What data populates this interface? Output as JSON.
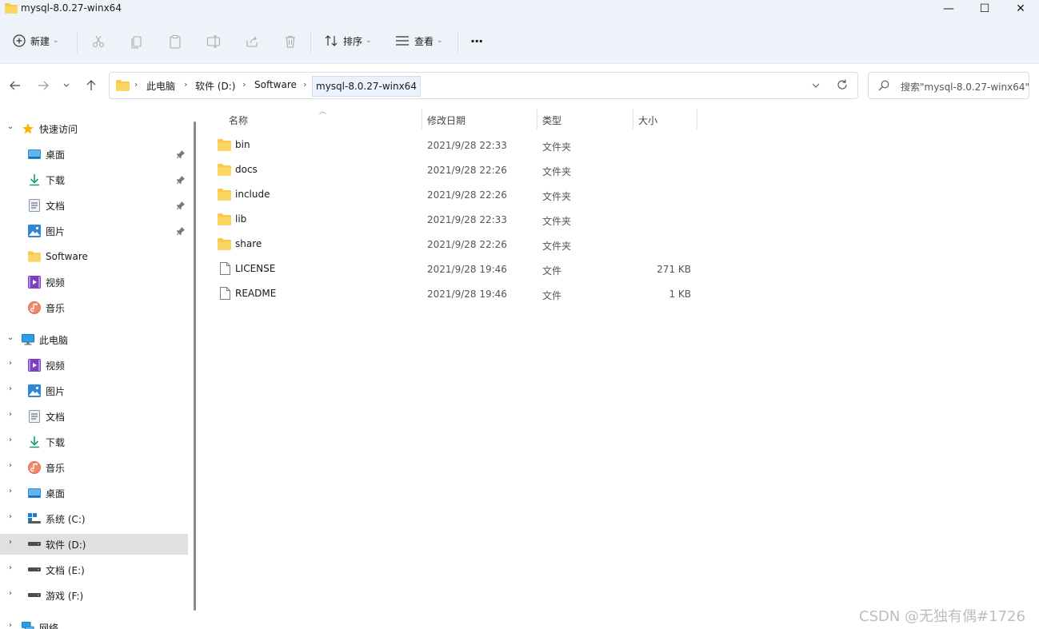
{
  "window": {
    "title": "mysql-8.0.27-winx64",
    "minimize_glyph": "—",
    "maximize_glyph": "☐",
    "close_glyph": "✕"
  },
  "toolbar": {
    "new_label": "新建",
    "sort_label": "排序",
    "view_label": "查看",
    "more_glyph": "···",
    "icons": [
      "cut-icon",
      "copy-icon",
      "paste-icon",
      "rename-icon",
      "share-icon",
      "delete-icon"
    ]
  },
  "address": {
    "crumbs": [
      "此电脑",
      "软件 (D:)",
      "Software",
      "mysql-8.0.27-winx64"
    ],
    "separator": "›"
  },
  "search": {
    "placeholder": "搜索\"mysql-8.0.27-winx64\""
  },
  "sidebar": {
    "quick_access": {
      "label": "快速访问",
      "items": [
        {
          "label": "桌面",
          "icon": "desktop-icon",
          "pinned": true
        },
        {
          "label": "下载",
          "icon": "download-icon",
          "pinned": true
        },
        {
          "label": "文档",
          "icon": "document-icon",
          "pinned": true
        },
        {
          "label": "图片",
          "icon": "pictures-icon",
          "pinned": true
        },
        {
          "label": "Software",
          "icon": "folder-icon",
          "pinned": false
        },
        {
          "label": "视频",
          "icon": "video-icon",
          "pinned": false
        },
        {
          "label": "音乐",
          "icon": "music-icon",
          "pinned": false
        }
      ]
    },
    "this_pc": {
      "label": "此电脑",
      "items": [
        {
          "label": "视频",
          "icon": "video-icon"
        },
        {
          "label": "图片",
          "icon": "pictures-icon"
        },
        {
          "label": "文档",
          "icon": "document-icon"
        },
        {
          "label": "下载",
          "icon": "download-icon"
        },
        {
          "label": "音乐",
          "icon": "music-icon"
        },
        {
          "label": "桌面",
          "icon": "desktop-icon"
        },
        {
          "label": "系统 (C:)",
          "icon": "system-drive-icon"
        },
        {
          "label": "软件 (D:)",
          "icon": "drive-icon",
          "selected": true
        },
        {
          "label": "文档 (E:)",
          "icon": "drive-icon"
        },
        {
          "label": "游戏 (F:)",
          "icon": "drive-icon"
        }
      ]
    },
    "network": {
      "label": "网络"
    }
  },
  "columns": {
    "name": "名称",
    "date": "修改日期",
    "type": "类型",
    "size": "大小"
  },
  "files": [
    {
      "name": "bin",
      "date": "2021/9/28 22:33",
      "type": "文件夹",
      "size": "",
      "kind": "folder"
    },
    {
      "name": "docs",
      "date": "2021/9/28 22:26",
      "type": "文件夹",
      "size": "",
      "kind": "folder"
    },
    {
      "name": "include",
      "date": "2021/9/28 22:26",
      "type": "文件夹",
      "size": "",
      "kind": "folder"
    },
    {
      "name": "lib",
      "date": "2021/9/28 22:33",
      "type": "文件夹",
      "size": "",
      "kind": "folder"
    },
    {
      "name": "share",
      "date": "2021/9/28 22:26",
      "type": "文件夹",
      "size": "",
      "kind": "folder"
    },
    {
      "name": "LICENSE",
      "date": "2021/9/28 19:46",
      "type": "文件",
      "size": "271 KB",
      "kind": "file"
    },
    {
      "name": "README",
      "date": "2021/9/28 19:46",
      "type": "文件",
      "size": "1 KB",
      "kind": "file"
    }
  ],
  "watermark": "CSDN @无独有偶#1726",
  "colors": {
    "folder": "#f8c94a",
    "accent": "#0067c0",
    "selected_bg": "#e0e0e0",
    "chrome_bg": "#eef3fa"
  }
}
